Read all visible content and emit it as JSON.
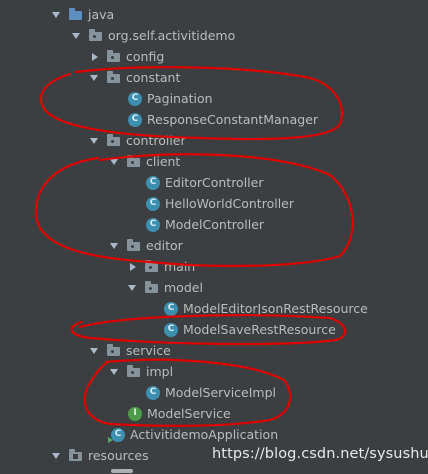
{
  "tree": {
    "java": "java",
    "package": "org.self.activitidemo",
    "config": "config",
    "constant": "constant",
    "pagination": "Pagination",
    "response_constant_manager": "ResponseConstantManager",
    "controller": "controller",
    "client": "client",
    "editor_controller": "EditorController",
    "hello_world_controller": "HelloWorldController",
    "model_controller": "ModelController",
    "editor": "editor",
    "main": "main",
    "model": "model",
    "model_editor_json_rest_resource": "ModelEditorJsonRestResource",
    "model_save_rest_resource": "ModelSaveRestResource",
    "service": "service",
    "impl": "impl",
    "model_service_impl": "ModelServiceImpl",
    "model_service": "ModelService",
    "application": "ActivitidemoApplication",
    "resources": "resources"
  },
  "icons": {
    "class_letter": "C",
    "interface_letter": "I"
  },
  "watermark": "https://blog.csdn.net/sysushui",
  "colors": {
    "background": "#3c3f41",
    "text": "#bbbbbb",
    "class_icon": "#3d8fb0",
    "interface_icon": "#4c9a4a",
    "annotation": "#e00000"
  }
}
